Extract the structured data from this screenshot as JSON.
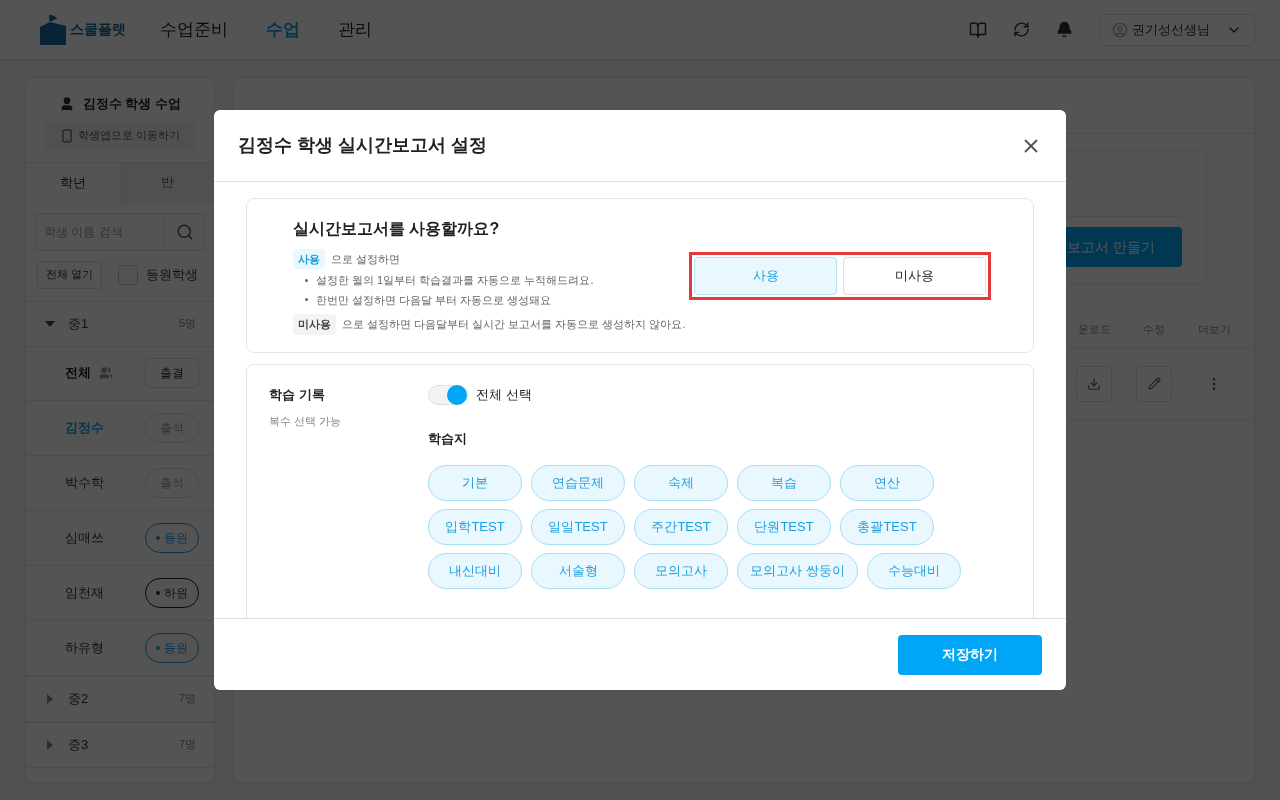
{
  "header": {
    "logo": "스쿨플랫",
    "nav": [
      {
        "label": "수업준비",
        "selected": false
      },
      {
        "label": "수업",
        "selected": true
      },
      {
        "label": "관리",
        "selected": false
      }
    ],
    "user": "권기성선생님"
  },
  "sidebar": {
    "title": "김정수 학생 수업",
    "app_button": "학생앱으로 이동하기",
    "tabs": [
      {
        "label": "학년",
        "selected": true
      },
      {
        "label": "반",
        "selected": false
      }
    ],
    "search": {
      "placeholder": "학생 이름 검색"
    },
    "expand_all": "전체 열기",
    "enrolled_filter": {
      "label": "등원학생",
      "checked": false
    },
    "groups": [
      {
        "name": "중1",
        "count": "5명",
        "expanded": true,
        "all_row": {
          "label": "전체",
          "button": "출결"
        },
        "students": [
          {
            "name": "김정수",
            "selected": true,
            "kind": "attend",
            "status": "출석"
          },
          {
            "name": "박수학",
            "selected": false,
            "kind": "attend",
            "status": "출석"
          },
          {
            "name": "심매쓰",
            "selected": false,
            "kind": "in",
            "status": "등원"
          },
          {
            "name": "임천재",
            "selected": false,
            "kind": "out",
            "status": "하원"
          },
          {
            "name": "하유형",
            "selected": false,
            "kind": "in",
            "status": "등원"
          }
        ]
      },
      {
        "name": "중2",
        "count": "7명",
        "expanded": false
      },
      {
        "name": "중3",
        "count": "7명",
        "expanded": false
      }
    ]
  },
  "main": {
    "create_button": "보고서 만들기",
    "columns": [
      "운로드",
      "수정",
      "더보기"
    ]
  },
  "modal": {
    "title": "김정수 학생 실시간보고서 설정",
    "usage": {
      "question": "실시간보고서를 사용할까요?",
      "use_tag": "사용",
      "use_text": "으로 설정하면",
      "bullets": [
        "설정한 월의 1일부터 학습결과를 자동으로 누적해드려요.",
        "한번만 설정하면 다음달 부터 자동으로 생성돼요"
      ],
      "unuse_tag": "미사용",
      "unuse_text": "으로 설정하면 다음달부터 실시간 보고서를 자동으로 생성하지 않아요.",
      "options": [
        {
          "label": "사용",
          "selected": true
        },
        {
          "label": "미사용",
          "selected": false
        }
      ]
    },
    "records": {
      "title": "학습 기록",
      "hint": "복수 선택 가능",
      "select_all": {
        "label": "전체 선택",
        "on": true
      },
      "group_title": "학습지",
      "chips": [
        {
          "label": "기본",
          "selected": true
        },
        {
          "label": "연습문제",
          "selected": true
        },
        {
          "label": "숙제",
          "selected": true
        },
        {
          "label": "복습",
          "selected": true
        },
        {
          "label": "연산",
          "selected": true
        },
        {
          "label": "입학TEST",
          "selected": true
        },
        {
          "label": "일일TEST",
          "selected": true
        },
        {
          "label": "주간TEST",
          "selected": true
        },
        {
          "label": "단원TEST",
          "selected": true
        },
        {
          "label": "총괄TEST",
          "selected": true
        },
        {
          "label": "내신대비",
          "selected": true
        },
        {
          "label": "서술형",
          "selected": true
        },
        {
          "label": "모의고사",
          "selected": true
        },
        {
          "label": "모의고사 쌍둥이",
          "selected": true
        },
        {
          "label": "수능대비",
          "selected": true
        }
      ]
    },
    "save_button": "저장하기"
  }
}
